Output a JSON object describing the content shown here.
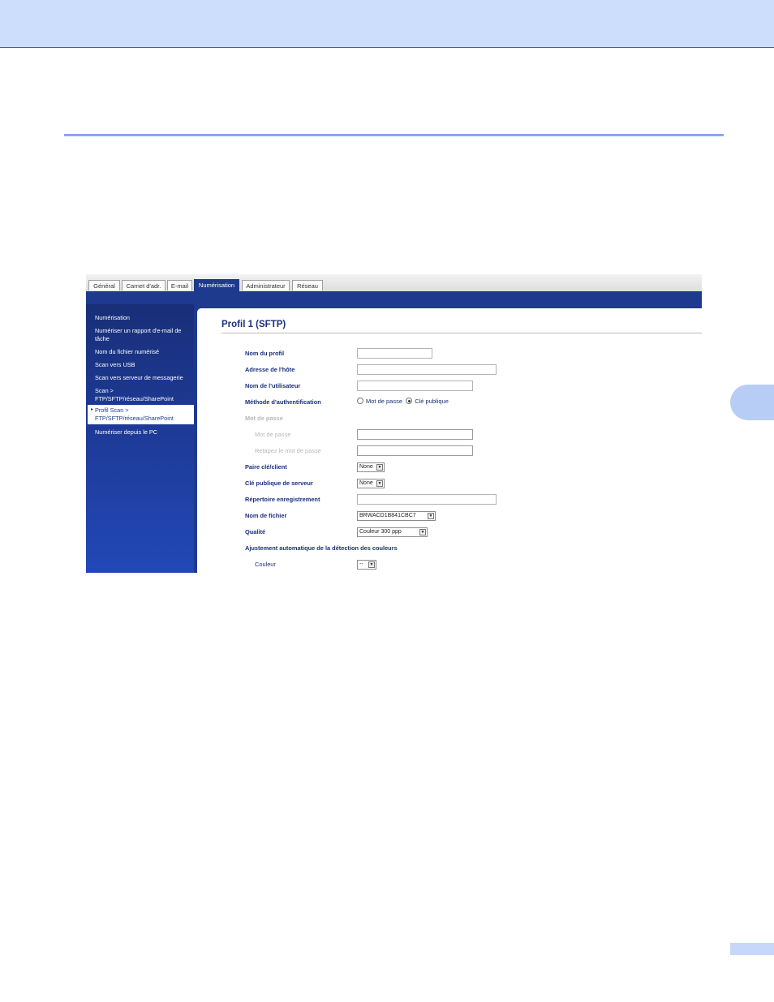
{
  "tabs": [
    "Général",
    "Carnet d'adr.",
    "E-mail",
    "Numérisation",
    "Administrateur",
    "Réseau"
  ],
  "active_tab": "Numérisation",
  "sidebar": {
    "items": [
      "Numérisation",
      "Numériser un rapport d'e-mail de tâche",
      "Nom du fichier numérisé",
      "Scan vers USB",
      "Scan vers serveur de messagerie",
      "Scan > FTP/SFTP/réseau/SharePoint",
      "Profil Scan > FTP/SFTP/réseau/SharePoint",
      "Numériser depuis le PC"
    ],
    "selected": "Profil Scan > FTP/SFTP/réseau/SharePoint"
  },
  "form": {
    "title": "Profil 1 (SFTP)",
    "profile_name_label": "Nom du profil",
    "host_label": "Adresse de l'hôte",
    "username_label": "Nom de l'utilisateur",
    "auth_label": "Méthode d'authentification",
    "auth_option_password": "Mot de passe",
    "auth_option_public_key": "Clé publique",
    "password_section_label": "Mot de passe",
    "password_label": "Mot de passe",
    "retype_password_label": "Retapez le mot de passe",
    "client_key_pair_label": "Paire clé/client",
    "client_key_pair_value": "None",
    "server_public_key_label": "Clé publique de serveur",
    "server_public_key_value": "None",
    "store_directory_label": "Répertoire enregistrement",
    "file_name_label": "Nom de fichier",
    "file_name_value": "BRWACD1B841CBC7",
    "quality_label": "Qualité",
    "quality_value": "Couleur 300 ppp",
    "auto_color_label": "Ajustement automatique de la détection des couleurs",
    "color_label": "Couleur",
    "color_value": "--"
  },
  "colors": {
    "nav_blue": "#1e3a8f",
    "label_blue": "#1a2f7a",
    "header_band": "#cdddfc",
    "section_rule": "#8aa6f2"
  }
}
